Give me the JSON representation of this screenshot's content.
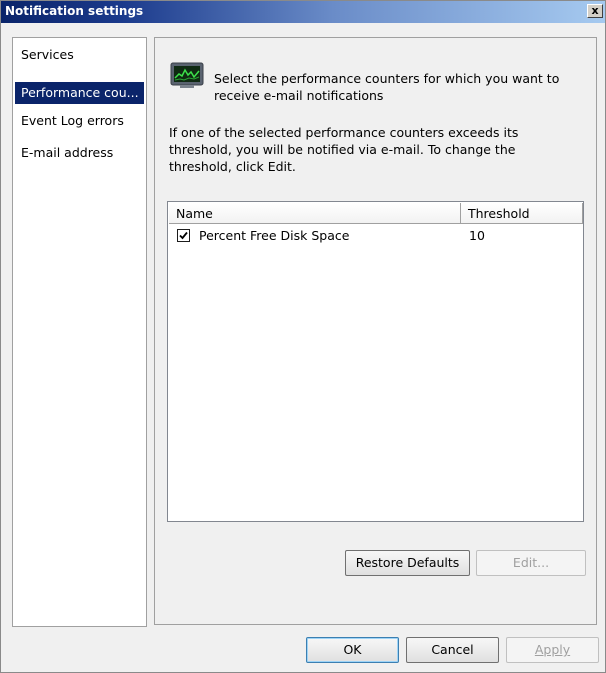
{
  "window": {
    "title": "Notification settings",
    "close_label": "x"
  },
  "sidebar": {
    "items": [
      {
        "label": "Services",
        "selected": false
      },
      {
        "label": "Performance cou...",
        "selected": true
      },
      {
        "label": "Event Log errors",
        "selected": false
      },
      {
        "label": "E-mail address",
        "selected": false
      }
    ]
  },
  "panel": {
    "icon": "performance-monitor-icon",
    "heading": "Select the performance counters for which you want to receive e-mail notifications",
    "description": "If one of the selected performance counters exceeds its threshold, you will be notified via e-mail. To change the threshold, click Edit.",
    "table": {
      "columns": [
        "Name",
        "Threshold"
      ],
      "rows": [
        {
          "checked": true,
          "name": "Percent Free Disk Space",
          "threshold": "10"
        }
      ]
    },
    "restore_defaults_label": "Restore Defaults",
    "edit_label": "Edit..."
  },
  "footer": {
    "ok_label": "OK",
    "cancel_label": "Cancel",
    "apply_label": "Apply"
  },
  "colors": {
    "title_bar_start": "#0a246a",
    "title_bar_end": "#a6caf0",
    "selection": "#0a246a"
  }
}
